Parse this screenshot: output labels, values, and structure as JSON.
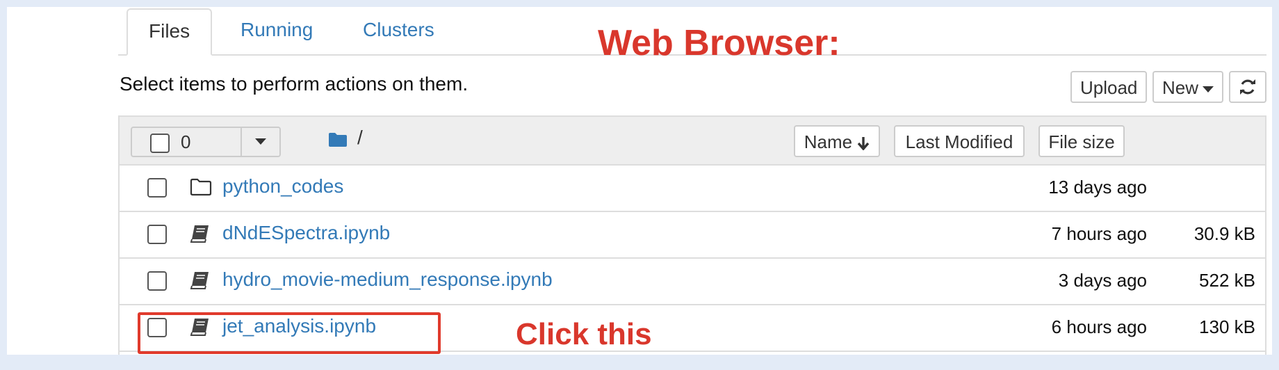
{
  "tabs": [
    {
      "label": "Files",
      "active": true
    },
    {
      "label": "Running",
      "active": false
    },
    {
      "label": "Clusters",
      "active": false
    }
  ],
  "annotations": {
    "title": "Web Browser:",
    "click_note": "Click this",
    "color": "#d9372c"
  },
  "toolbar": {
    "hint": "Select items to perform actions on them.",
    "upload_label": "Upload",
    "new_label": "New",
    "refresh_icon": "refresh-icon"
  },
  "list_header": {
    "selected_count": "0",
    "path": "/",
    "sort_name_label": "Name",
    "sort_modified_label": "Last Modified",
    "sort_size_label": "File size"
  },
  "files": [
    {
      "name": "python_codes",
      "type": "folder",
      "modified": "13 days ago",
      "size": ""
    },
    {
      "name": "dNdESpectra.ipynb",
      "type": "notebook",
      "modified": "7 hours ago",
      "size": "30.9 kB"
    },
    {
      "name": "hydro_movie-medium_response.ipynb",
      "type": "notebook",
      "modified": "3 days ago",
      "size": "522 kB"
    },
    {
      "name": "jet_analysis.ipynb",
      "type": "notebook",
      "modified": "6 hours ago",
      "size": "130 kB",
      "highlighted": true
    }
  ],
  "colors": {
    "link": "#337ab7",
    "border": "#dddddd",
    "header_bg": "#eeeeee",
    "page_bg": "#e3ebf7"
  }
}
